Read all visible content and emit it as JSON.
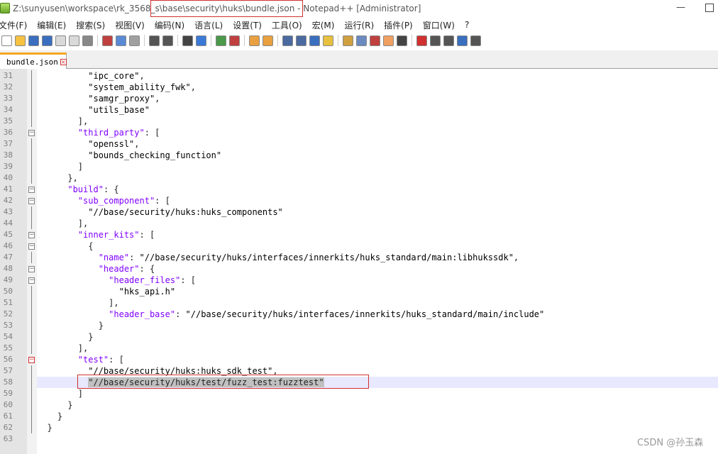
{
  "window": {
    "title": "Z:\\sunyusen\\workspace\\rk_3568_s\\base\\security\\huks\\bundle.json - Notepad++ [Administrator]",
    "minimize": "—"
  },
  "menu": [
    "文件(F)",
    "编辑(E)",
    "搜索(S)",
    "视图(V)",
    "编码(N)",
    "语言(L)",
    "设置(T)",
    "工具(O)",
    "宏(M)",
    "运行(R)",
    "插件(P)",
    "窗口(W)",
    "?"
  ],
  "toolbar_icons": [
    {
      "name": "new-file-icon",
      "color": "#ffffff"
    },
    {
      "name": "open-file-icon",
      "color": "#f5c242"
    },
    {
      "name": "save-icon",
      "color": "#3a6fbf"
    },
    {
      "name": "save-all-icon",
      "color": "#3a6fbf"
    },
    {
      "name": "close-icon",
      "color": "#d9d9d9"
    },
    {
      "name": "close-all-icon",
      "color": "#d9d9d9"
    },
    {
      "name": "print-icon",
      "color": "#888888"
    },
    {
      "name": "cut-icon",
      "color": "#c04040"
    },
    {
      "name": "copy-icon",
      "color": "#5a8ad6"
    },
    {
      "name": "paste-icon",
      "color": "#a0a0a0"
    },
    {
      "name": "undo-icon",
      "color": "#555555"
    },
    {
      "name": "redo-icon",
      "color": "#555555"
    },
    {
      "name": "find-icon",
      "color": "#444444"
    },
    {
      "name": "replace-icon",
      "color": "#3a7ad6"
    },
    {
      "name": "zoom-in-icon",
      "color": "#4a9a4a"
    },
    {
      "name": "zoom-out-icon",
      "color": "#c04040"
    },
    {
      "name": "sync-vertical-icon",
      "color": "#e8a040"
    },
    {
      "name": "sync-horizontal-icon",
      "color": "#e8a040"
    },
    {
      "name": "word-wrap-icon",
      "color": "#4a6aa0"
    },
    {
      "name": "show-all-chars-icon",
      "color": "#4a6aa0"
    },
    {
      "name": "indent-guide-icon",
      "color": "#3a6fbf"
    },
    {
      "name": "user-lang-icon",
      "color": "#e8c040"
    },
    {
      "name": "doc-map-icon",
      "color": "#d0a040"
    },
    {
      "name": "function-list-icon",
      "color": "#6a8ac0"
    },
    {
      "name": "folder-as-workspace-icon",
      "color": "#c04040"
    },
    {
      "name": "folder-icon",
      "color": "#f0a060"
    },
    {
      "name": "monitoring-icon",
      "color": "#444444"
    },
    {
      "name": "record-macro-icon",
      "color": "#d03030"
    },
    {
      "name": "stop-record-icon",
      "color": "#555555"
    },
    {
      "name": "playback-icon",
      "color": "#555555"
    },
    {
      "name": "run-macro-multiple-icon",
      "color": "#3a6fbf"
    },
    {
      "name": "save-macro-icon",
      "color": "#555555"
    }
  ],
  "tab": {
    "label": "bundle.json",
    "close": "×"
  },
  "lines": [
    {
      "n": "31",
      "tokens": [
        {
          "t": "          "
        },
        {
          "t": "\"ipc_core\"",
          "c": "str"
        },
        {
          "t": ","
        }
      ]
    },
    {
      "n": "32",
      "tokens": [
        {
          "t": "          "
        },
        {
          "t": "\"system_ability_fwk\"",
          "c": "str"
        },
        {
          "t": ","
        }
      ]
    },
    {
      "n": "33",
      "tokens": [
        {
          "t": "          "
        },
        {
          "t": "\"samgr_proxy\"",
          "c": "str"
        },
        {
          "t": ","
        }
      ]
    },
    {
      "n": "34",
      "tokens": [
        {
          "t": "          "
        },
        {
          "t": "\"utils_base\"",
          "c": "str"
        }
      ]
    },
    {
      "n": "35",
      "tokens": [
        {
          "t": "        ],"
        }
      ]
    },
    {
      "n": "36",
      "tokens": [
        {
          "t": "        "
        },
        {
          "t": "\"third_party\"",
          "c": "k"
        },
        {
          "t": ": ["
        }
      ]
    },
    {
      "n": "37",
      "tokens": [
        {
          "t": "          "
        },
        {
          "t": "\"openssl\"",
          "c": "str"
        },
        {
          "t": ","
        }
      ]
    },
    {
      "n": "38",
      "tokens": [
        {
          "t": "          "
        },
        {
          "t": "\"bounds_checking_function\"",
          "c": "str"
        }
      ]
    },
    {
      "n": "39",
      "tokens": [
        {
          "t": "        ]"
        }
      ]
    },
    {
      "n": "40",
      "tokens": [
        {
          "t": "      },"
        }
      ]
    },
    {
      "n": "41",
      "tokens": [
        {
          "t": "      "
        },
        {
          "t": "\"build\"",
          "c": "k"
        },
        {
          "t": ": {"
        }
      ]
    },
    {
      "n": "42",
      "tokens": [
        {
          "t": "        "
        },
        {
          "t": "\"sub_component\"",
          "c": "k"
        },
        {
          "t": ": ["
        }
      ]
    },
    {
      "n": "43",
      "tokens": [
        {
          "t": "          "
        },
        {
          "t": "\"//base/security/huks:huks_components\"",
          "c": "str"
        }
      ]
    },
    {
      "n": "44",
      "tokens": [
        {
          "t": "        ],"
        }
      ]
    },
    {
      "n": "45",
      "tokens": [
        {
          "t": "        "
        },
        {
          "t": "\"inner_kits\"",
          "c": "k"
        },
        {
          "t": ": ["
        }
      ]
    },
    {
      "n": "46",
      "tokens": [
        {
          "t": "          {"
        }
      ]
    },
    {
      "n": "47",
      "tokens": [
        {
          "t": "            "
        },
        {
          "t": "\"name\"",
          "c": "k"
        },
        {
          "t": ": "
        },
        {
          "t": "\"//base/security/huks/interfaces/innerkits/huks_standard/main:libhukssdk\"",
          "c": "str"
        },
        {
          "t": ","
        }
      ]
    },
    {
      "n": "48",
      "tokens": [
        {
          "t": "            "
        },
        {
          "t": "\"header\"",
          "c": "k"
        },
        {
          "t": ": {"
        }
      ]
    },
    {
      "n": "49",
      "tokens": [
        {
          "t": "              "
        },
        {
          "t": "\"header_files\"",
          "c": "k"
        },
        {
          "t": ": ["
        }
      ]
    },
    {
      "n": "50",
      "tokens": [
        {
          "t": "                "
        },
        {
          "t": "\"hks_api.h\"",
          "c": "str"
        }
      ]
    },
    {
      "n": "51",
      "tokens": [
        {
          "t": "              ],"
        }
      ]
    },
    {
      "n": "52",
      "tokens": [
        {
          "t": "              "
        },
        {
          "t": "\"header_base\"",
          "c": "k"
        },
        {
          "t": ": "
        },
        {
          "t": "\"//base/security/huks/interfaces/innerkits/huks_standard/main/include\"",
          "c": "str"
        }
      ]
    },
    {
      "n": "53",
      "tokens": [
        {
          "t": "            }"
        }
      ]
    },
    {
      "n": "54",
      "tokens": [
        {
          "t": "          }"
        }
      ]
    },
    {
      "n": "55",
      "tokens": [
        {
          "t": "        ],"
        }
      ]
    },
    {
      "n": "56",
      "tokens": [
        {
          "t": "        "
        },
        {
          "t": "\"test\"",
          "c": "k"
        },
        {
          "t": ": ["
        }
      ]
    },
    {
      "n": "57",
      "tokens": [
        {
          "t": "          "
        },
        {
          "t": "\"//base/security/huks:huks_sdk_test\"",
          "c": "str"
        },
        {
          "t": ","
        }
      ]
    },
    {
      "n": "58",
      "tokens": [
        {
          "t": "          "
        },
        {
          "t": "\"//base/security/huks/test/fuzz_test:fuzztest\"",
          "c": "sel"
        }
      ]
    },
    {
      "n": "59",
      "tokens": [
        {
          "t": "        ]"
        }
      ]
    },
    {
      "n": "60",
      "tokens": [
        {
          "t": "      }"
        }
      ]
    },
    {
      "n": "61",
      "tokens": [
        {
          "t": "    }"
        }
      ]
    },
    {
      "n": "62",
      "tokens": [
        {
          "t": "  }"
        }
      ]
    },
    {
      "n": "63",
      "tokens": []
    }
  ],
  "fold_markers": [
    {
      "line": "36",
      "sym": "−"
    },
    {
      "line": "41",
      "sym": "−"
    },
    {
      "line": "42",
      "sym": "−"
    },
    {
      "line": "45",
      "sym": "−"
    },
    {
      "line": "46",
      "sym": "−"
    },
    {
      "line": "48",
      "sym": "−"
    },
    {
      "line": "49",
      "sym": "−"
    },
    {
      "line": "56",
      "sym": "−",
      "red": true
    }
  ],
  "current_line": "58",
  "watermark": "CSDN @孙玉森"
}
